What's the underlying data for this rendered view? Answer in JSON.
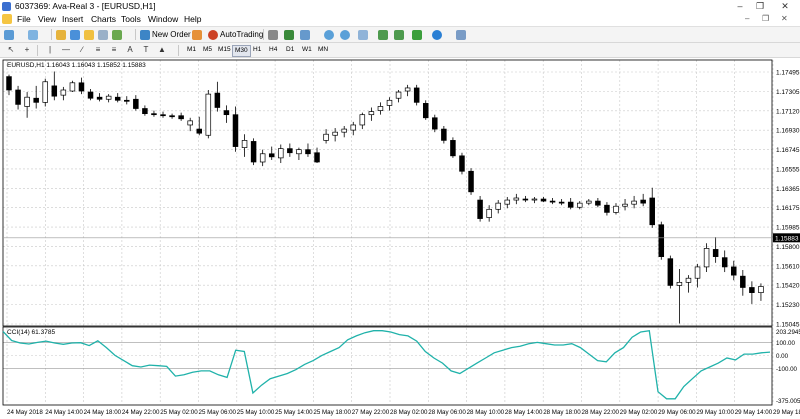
{
  "window": {
    "title": "6037369: Ava-Real 3 - [EURUSD,H1]"
  },
  "menu": [
    "File",
    "View",
    "Insert",
    "Charts",
    "Tools",
    "Window",
    "Help"
  ],
  "toolbar": {
    "new_order": "New Order",
    "auto_trading": "AutoTrading"
  },
  "draw_tools": {
    "text_tool": "A",
    "label_tool": "T"
  },
  "timeframes": [
    "M1",
    "M5",
    "M15",
    "M30",
    "H1",
    "H4",
    "D1",
    "W1",
    "MN"
  ],
  "timeframe_active": "M30",
  "chart": {
    "symbol_info": "EURUSD,H1  1.16043 1.16043 1.15852 1.15883",
    "price_ticks": [
      "1.17495",
      "1.17305",
      "1.17120",
      "1.16930",
      "1.16745",
      "1.16555",
      "1.16365",
      "1.16175",
      "1.15985",
      "1.15800",
      "1.15610",
      "1.15420",
      "1.15230",
      "1.15045"
    ],
    "current_price": "1.15883",
    "time_labels": [
      "24 May 2018",
      "24 May 14:00",
      "24 May 18:00",
      "24 May 22:00",
      "25 May 02:00",
      "25 May 06:00",
      "25 May 10:00",
      "25 May 14:00",
      "25 May 18:00",
      "27 May 22:00",
      "28 May 02:00",
      "28 May 06:00",
      "28 May 10:00",
      "28 May 14:00",
      "28 May 18:00",
      "28 May 22:00",
      "29 May 02:00",
      "29 May 06:00",
      "29 May 10:00",
      "29 May 14:00",
      "29 May 18:00"
    ]
  },
  "cci": {
    "label": "CCI(14) 61.3785",
    "ticks": [
      "203.2945",
      "100.00",
      "0.00",
      "-100.00",
      "-375.0055"
    ],
    "colors": {
      "line": "#20b2aa"
    }
  },
  "colors": {
    "candle": "#000000",
    "grid": "#c8c8c8",
    "background": "#ffffff"
  },
  "chart_data": {
    "type": "candlestick",
    "symbol": "EURUSD",
    "timeframe": "H1",
    "ylim": [
      1.15045,
      1.17495
    ],
    "candles": [
      [
        1.1745,
        1.1747,
        1.1727,
        1.1732
      ],
      [
        1.1732,
        1.1736,
        1.1713,
        1.1718
      ],
      [
        1.1716,
        1.173,
        1.1705,
        1.1725
      ],
      [
        1.1724,
        1.1736,
        1.1714,
        1.172
      ],
      [
        1.172,
        1.1743,
        1.1716,
        1.174
      ],
      [
        1.1736,
        1.175,
        1.1722,
        1.1726
      ],
      [
        1.1727,
        1.1735,
        1.1722,
        1.1732
      ],
      [
        1.1731,
        1.1741,
        1.173,
        1.1739
      ],
      [
        1.1739,
        1.1744,
        1.1728,
        1.1731
      ],
      [
        1.173,
        1.1733,
        1.1722,
        1.1724
      ],
      [
        1.1725,
        1.1729,
        1.1721,
        1.1723
      ],
      [
        1.1723,
        1.1728,
        1.172,
        1.1726
      ],
      [
        1.1725,
        1.1729,
        1.172,
        1.1722
      ],
      [
        1.1722,
        1.1726,
        1.1718,
        1.1721
      ],
      [
        1.1723,
        1.1727,
        1.1712,
        1.1714
      ],
      [
        1.1714,
        1.1717,
        1.1707,
        1.1709
      ],
      [
        1.1709,
        1.1712,
        1.1706,
        1.1708
      ],
      [
        1.1708,
        1.1711,
        1.1705,
        1.1707
      ],
      [
        1.1707,
        1.1709,
        1.1704,
        1.1706
      ],
      [
        1.1707,
        1.171,
        1.1702,
        1.1704
      ],
      [
        1.1698,
        1.1705,
        1.1692,
        1.1702
      ],
      [
        1.1694,
        1.1706,
        1.1688,
        1.169
      ],
      [
        1.1688,
        1.1732,
        1.1685,
        1.1728
      ],
      [
        1.1729,
        1.174,
        1.1711,
        1.1715
      ],
      [
        1.1712,
        1.1717,
        1.17,
        1.1708
      ],
      [
        1.1708,
        1.1716,
        1.1672,
        1.1677
      ],
      [
        1.1676,
        1.1689,
        1.1667,
        1.1683
      ],
      [
        1.1682,
        1.1685,
        1.1659,
        1.1662
      ],
      [
        1.1662,
        1.1674,
        1.1658,
        1.167
      ],
      [
        1.167,
        1.1677,
        1.1664,
        1.1667
      ],
      [
        1.1666,
        1.1679,
        1.1661,
        1.1675
      ],
      [
        1.1675,
        1.168,
        1.1667,
        1.1671
      ],
      [
        1.167,
        1.1676,
        1.1664,
        1.1674
      ],
      [
        1.1674,
        1.168,
        1.1667,
        1.167
      ],
      [
        1.1671,
        1.1676,
        1.1661,
        1.1662
      ],
      [
        1.1683,
        1.1694,
        1.168,
        1.1689
      ],
      [
        1.1688,
        1.1695,
        1.1682,
        1.1691
      ],
      [
        1.1691,
        1.1697,
        1.1686,
        1.1694
      ],
      [
        1.1693,
        1.1701,
        1.1688,
        1.1698
      ],
      [
        1.1698,
        1.171,
        1.1694,
        1.1708
      ],
      [
        1.1708,
        1.1715,
        1.1702,
        1.1711
      ],
      [
        1.1712,
        1.172,
        1.1708,
        1.1716
      ],
      [
        1.1717,
        1.1725,
        1.1712,
        1.1722
      ],
      [
        1.1724,
        1.1732,
        1.172,
        1.173
      ],
      [
        1.1731,
        1.1737,
        1.1726,
        1.1734
      ],
      [
        1.1734,
        1.1737,
        1.1717,
        1.172
      ],
      [
        1.1719,
        1.1722,
        1.1703,
        1.1705
      ],
      [
        1.1705,
        1.1708,
        1.1691,
        1.1694
      ],
      [
        1.1694,
        1.1697,
        1.168,
        1.1683
      ],
      [
        1.1683,
        1.1686,
        1.1666,
        1.1668
      ],
      [
        1.1668,
        1.1671,
        1.165,
        1.1653
      ],
      [
        1.1653,
        1.1656,
        1.163,
        1.1633
      ],
      [
        1.1625,
        1.1629,
        1.1604,
        1.1607
      ],
      [
        1.1608,
        1.162,
        1.1604,
        1.1616
      ],
      [
        1.1616,
        1.1625,
        1.1612,
        1.1622
      ],
      [
        1.1621,
        1.1628,
        1.1617,
        1.1625
      ],
      [
        1.1625,
        1.1631,
        1.1621,
        1.1627
      ],
      [
        1.1626,
        1.1629,
        1.1623,
        1.1625
      ],
      [
        1.1625,
        1.1628,
        1.1622,
        1.1626
      ],
      [
        1.1626,
        1.1628,
        1.1623,
        1.1624
      ],
      [
        1.1624,
        1.1627,
        1.1621,
        1.1623
      ],
      [
        1.1623,
        1.1626,
        1.162,
        1.1622
      ],
      [
        1.1623,
        1.1627,
        1.1616,
        1.1618
      ],
      [
        1.1618,
        1.1624,
        1.1616,
        1.1622
      ],
      [
        1.1622,
        1.1626,
        1.162,
        1.1624
      ],
      [
        1.1624,
        1.1627,
        1.1618,
        1.162
      ],
      [
        1.162,
        1.1623,
        1.161,
        1.1613
      ],
      [
        1.1613,
        1.1622,
        1.1611,
        1.1619
      ],
      [
        1.1619,
        1.1626,
        1.1615,
        1.1621
      ],
      [
        1.1621,
        1.1629,
        1.1617,
        1.1624
      ],
      [
        1.1625,
        1.1631,
        1.1619,
        1.1622
      ],
      [
        1.1627,
        1.1637,
        1.1598,
        1.1601
      ],
      [
        1.1601,
        1.1604,
        1.1567,
        1.157
      ],
      [
        1.1568,
        1.1571,
        1.1539,
        1.1542
      ],
      [
        1.1542,
        1.1558,
        1.1505,
        1.1545
      ],
      [
        1.1545,
        1.1552,
        1.1535,
        1.1549
      ],
      [
        1.1549,
        1.1563,
        1.154,
        1.156
      ],
      [
        1.156,
        1.1583,
        1.1555,
        1.1578
      ],
      [
        1.1577,
        1.1589,
        1.1564,
        1.157
      ],
      [
        1.1569,
        1.1576,
        1.1555,
        1.156
      ],
      [
        1.156,
        1.1566,
        1.1547,
        1.1552
      ],
      [
        1.1551,
        1.1557,
        1.1532,
        1.154
      ],
      [
        1.154,
        1.1546,
        1.1524,
        1.1535
      ],
      [
        1.1535,
        1.1544,
        1.1527,
        1.1541
      ]
    ],
    "cci_range": [
      -375.0055,
      203.2945
    ],
    "cci_levels": [
      100,
      0,
      -100
    ],
    "cci_values": [
      185,
      115,
      95,
      88,
      100,
      110,
      95,
      85,
      95,
      98,
      75,
      112,
      60,
      0,
      -40,
      -80,
      -90,
      -75,
      -80,
      -85,
      -160,
      -150,
      -130,
      -120,
      -120,
      -150,
      -170,
      40,
      30,
      -290,
      -230,
      -180,
      -160,
      -140,
      -110,
      -70,
      -40,
      0,
      30,
      60,
      120,
      150,
      175,
      190,
      190,
      180,
      160,
      150,
      110,
      30,
      -20,
      -60,
      -120,
      -140,
      -100,
      -60,
      -20,
      20,
      40,
      60,
      70,
      90,
      100,
      90,
      80,
      80,
      90,
      60,
      10,
      -40,
      -50,
      20,
      60,
      140,
      180,
      190,
      -280,
      -335,
      -335,
      -240,
      -180,
      -120,
      -90,
      -60,
      -20,
      -35,
      10,
      10,
      20,
      25
    ]
  }
}
